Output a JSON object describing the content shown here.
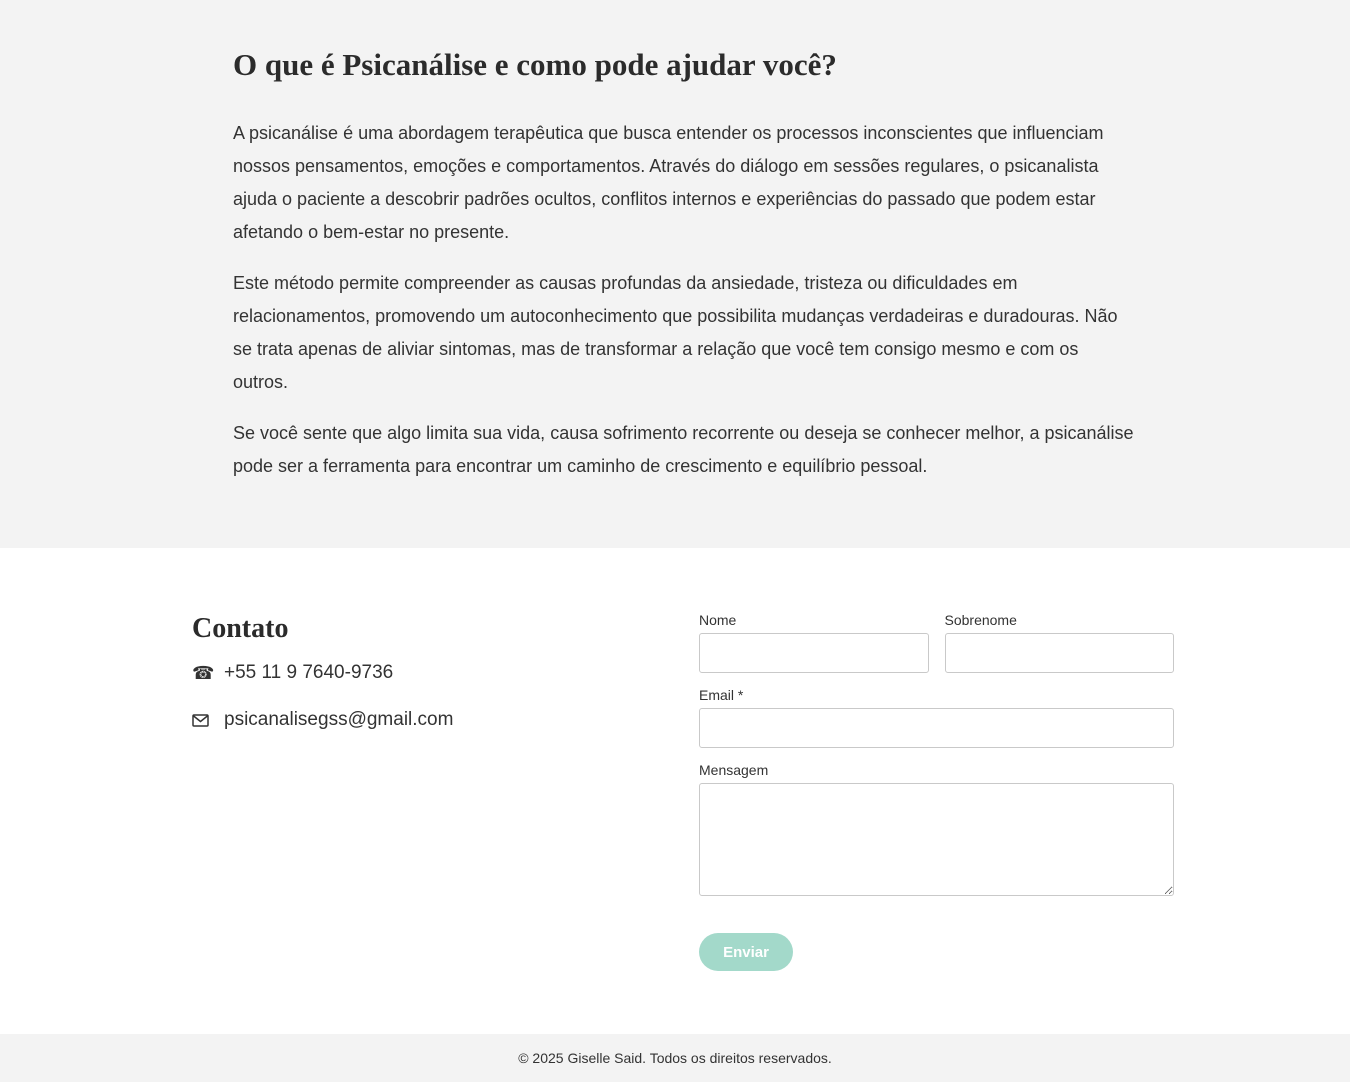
{
  "about": {
    "title": "O que é Psicanálise e como pode ajudar você?",
    "paragraphs": [
      "A psicanálise é uma abordagem terapêutica que busca entender os processos inconscientes que influenciam nossos pensamentos, emoções e comportamentos. Através do diálogo em sessões regulares, o psicanalista ajuda o paciente a descobrir padrões ocultos, conflitos internos e experiências do passado que podem estar afetando o bem-estar no presente.",
      "Este método permite compreender as causas profundas da ansiedade, tristeza ou dificuldades em relacionamentos, promovendo um autoconhecimento que possibilita mudanças verdadeiras e duradouras. Não se trata apenas de aliviar sintomas, mas de transformar a relação que você tem consigo mesmo e com os outros.",
      "Se você sente que algo limita sua vida, causa sofrimento recorrente ou deseja se conhecer melhor, a psicanálise pode ser a ferramenta para encontrar um caminho de crescimento e equilíbrio pessoal."
    ]
  },
  "contact": {
    "title": "Contato",
    "phone": {
      "icon": "phone-icon",
      "text": "+55 11 9 7640-9736"
    },
    "email": {
      "icon": "mail-icon",
      "text": "psicanalisegss@gmail.com"
    }
  },
  "form": {
    "first_name_label": "Nome",
    "first_name_value": "",
    "last_name_label": "Sobrenome",
    "last_name_value": "",
    "email_label": "Email *",
    "email_value": "",
    "message_label": "Mensagem",
    "message_value": "",
    "submit_label": "Enviar"
  },
  "colors": {
    "section_background": "#f3f3f3",
    "button_accent": "#a3d9ca"
  },
  "footer": {
    "copyright": "© 2025 Giselle Said. Todos os direitos reservados."
  }
}
